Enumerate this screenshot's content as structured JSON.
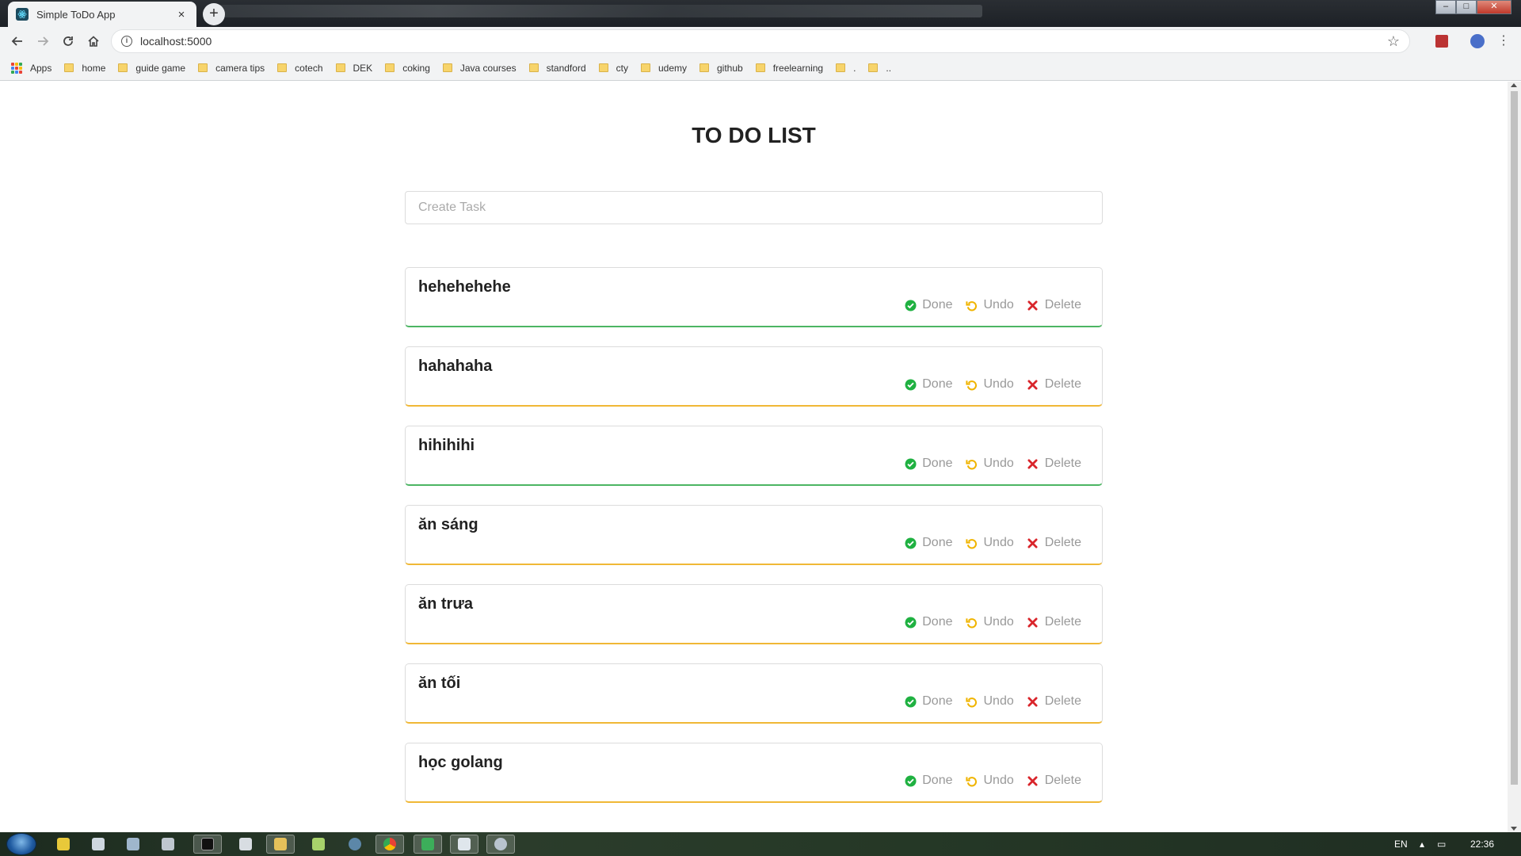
{
  "browser": {
    "tab_title": "Simple ToDo App",
    "tab_close": "×",
    "new_tab": "+",
    "url": "localhost:5000",
    "bookmarks": [
      "Apps",
      "home",
      "guide game",
      "camera tips",
      "cotech",
      "DEK",
      "coking",
      "Java courses",
      "standford",
      "cty",
      "udemy",
      "github",
      "freelearning",
      ".",
      ".."
    ]
  },
  "app": {
    "title": "TO DO LIST",
    "input_placeholder": "Create Task",
    "done_label": "Done",
    "undo_label": "Undo",
    "delete_label": "Delete",
    "tasks": [
      {
        "name": "hehehehehe",
        "accent": "#4cb563"
      },
      {
        "name": "hahahaha",
        "accent": "#f0b836"
      },
      {
        "name": "hihihihi",
        "accent": "#4cb563"
      },
      {
        "name": "ăn sáng",
        "accent": "#f0b836"
      },
      {
        "name": "ăn trưa",
        "accent": "#f0b836"
      },
      {
        "name": "ăn tối",
        "accent": "#f0b836"
      },
      {
        "name": "học golang",
        "accent": "#f0b836"
      }
    ]
  },
  "colors": {
    "done_icon": "#1fb141",
    "undo_icon": "#f0b400",
    "delete_icon": "#d9252b"
  },
  "taskbar": {
    "language": "EN",
    "time": "22:36"
  }
}
